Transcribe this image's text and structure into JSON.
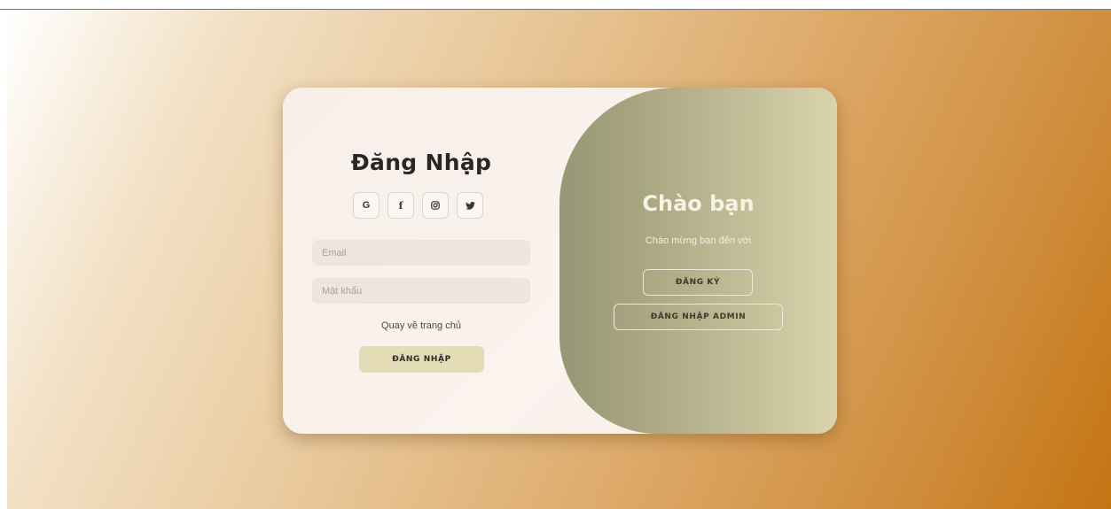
{
  "login": {
    "title": "Đăng Nhập",
    "socials": [
      {
        "icon": "google-icon",
        "glyph": "G"
      },
      {
        "icon": "facebook-icon",
        "glyph": "f"
      },
      {
        "icon": "instagram-icon",
        "glyph": ""
      },
      {
        "icon": "twitter-icon",
        "glyph": ""
      }
    ],
    "email_placeholder": "Email",
    "email_value": "",
    "password_placeholder": "Mật khẩu",
    "password_value": "",
    "home_link": "Quay về trang chủ",
    "submit_label": "ĐĂNG NHẬP"
  },
  "welcome": {
    "title": "Chào bạn",
    "subtitle": "Chào mừng bạn đến với",
    "register_label": "ĐĂNG KÝ",
    "admin_label": "ĐĂNG NHẬP ADMIN"
  },
  "colors": {
    "accent_button": "#e4dcb7",
    "panel_start": "#979675",
    "panel_end": "#d9d4ad",
    "background_end": "#c47412"
  }
}
